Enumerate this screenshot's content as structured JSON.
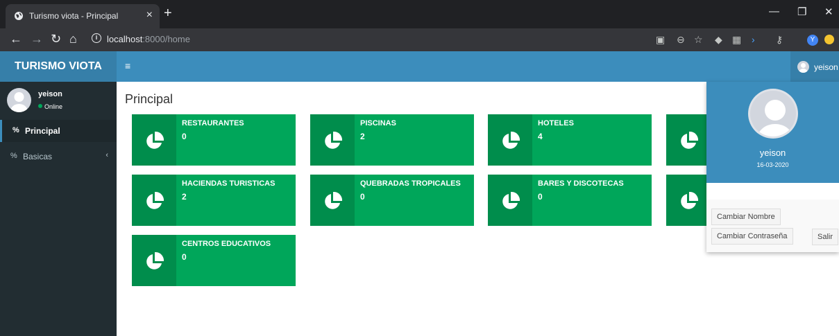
{
  "browser": {
    "tab_title": "Turismo viota - Principal",
    "tab_close": "×",
    "new_tab": "+",
    "url_host": "localhost",
    "url_path": ":8000/home",
    "profile_initial": "Y"
  },
  "app": {
    "brand": "TURISMO VIOTA",
    "toggle": "≡",
    "user_name": "yeison"
  },
  "sidebar": {
    "user_name": "yeison",
    "status": "Online",
    "items": [
      {
        "label": "Principal",
        "active": true
      },
      {
        "label": "Basicas",
        "active": false
      }
    ]
  },
  "main": {
    "title": "Principal",
    "boxes": [
      {
        "label": "RESTAURANTES",
        "value": "0"
      },
      {
        "label": "PISCINAS",
        "value": "2"
      },
      {
        "label": "HOTELES",
        "value": "4"
      },
      {
        "label": "",
        "value": ""
      },
      {
        "label": "HACIENDAS TURISTICAS",
        "value": "2"
      },
      {
        "label": "QUEBRADAS TROPICALES",
        "value": "0"
      },
      {
        "label": "BARES Y DISCOTECAS",
        "value": "0"
      },
      {
        "label": "",
        "value": ""
      },
      {
        "label": "CENTROS EDUCATIVOS",
        "value": "0"
      }
    ]
  },
  "dropdown": {
    "user_name": "yeison",
    "date": "16-03-2020",
    "btn_change_name": "Cambiar Nombre",
    "btn_change_password": "Cambiar Contraseña",
    "btn_logout": "Salir"
  },
  "colors": {
    "box_green": "#00a65a",
    "box_icon_green": "#008d4c",
    "header_blue": "#3c8dbc",
    "sidebar_dark": "#222d32"
  },
  "icons": [
    "globe-icon",
    "back-icon",
    "forward-icon",
    "reload-icon",
    "home-icon",
    "info-icon",
    "translate-icon",
    "zoom-icon",
    "star-icon",
    "pie-chart-icon",
    "share-icon",
    "user-icon"
  ]
}
